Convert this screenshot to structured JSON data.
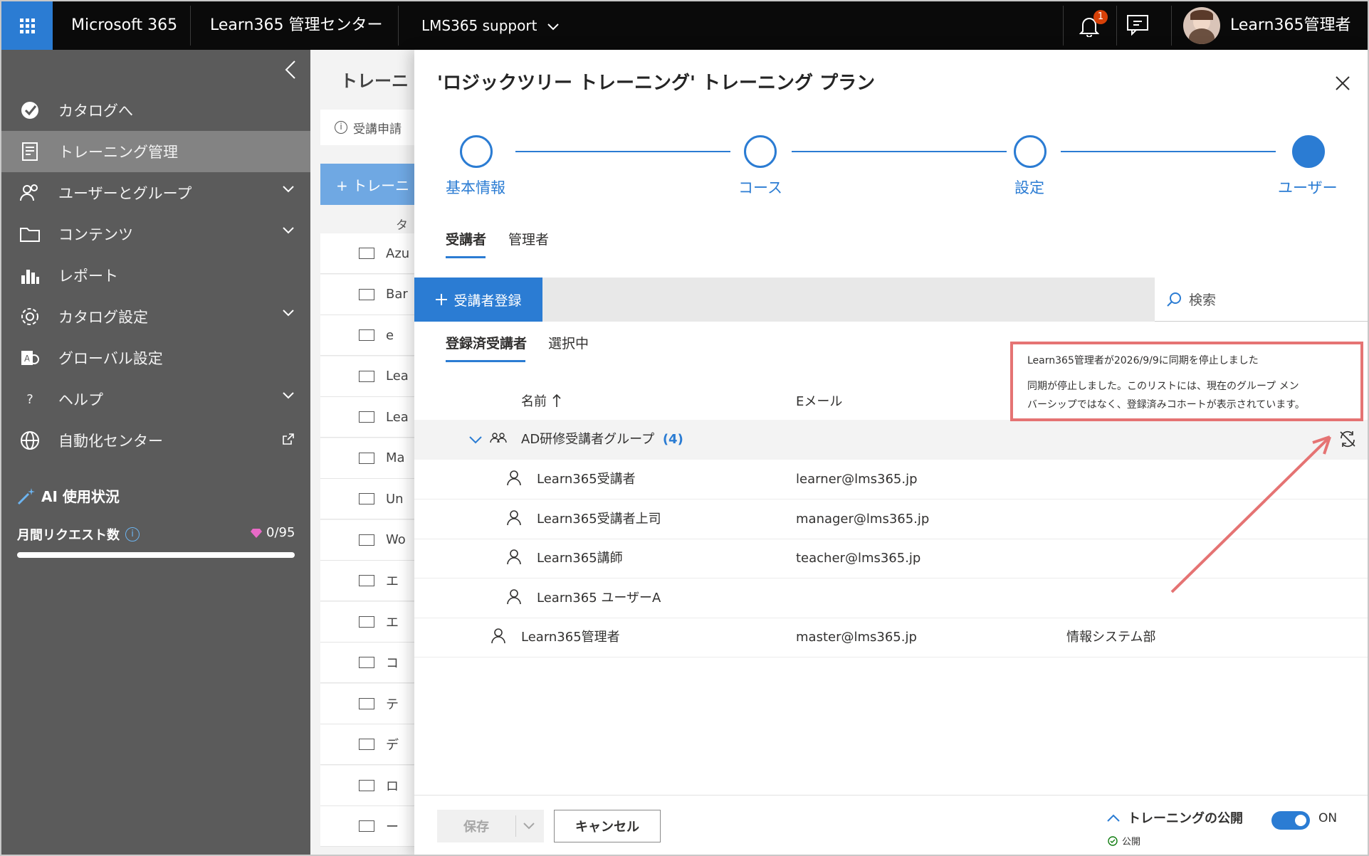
{
  "topbar": {
    "brand": "Microsoft 365",
    "app_title": "Learn365 管理センター",
    "tenant": "LMS365 support",
    "notification_count": "1",
    "user_name": "Learn365管理者"
  },
  "sidebar": {
    "items": [
      {
        "label": "カタログへ",
        "icon": "catalog-check-icon"
      },
      {
        "label": "トレーニング管理",
        "icon": "training-document-icon"
      },
      {
        "label": "ユーザーとグループ",
        "icon": "users-icon"
      },
      {
        "label": "コンテンツ",
        "icon": "folder-icon"
      },
      {
        "label": "レポート",
        "icon": "chart-icon"
      },
      {
        "label": "カタログ設定",
        "icon": "gear-icon"
      },
      {
        "label": "グローバル設定",
        "icon": "global-settings-icon"
      },
      {
        "label": "ヘルプ",
        "icon": "help-icon"
      },
      {
        "label": "自動化センター",
        "icon": "globe-icon"
      }
    ],
    "ai_title": "AI 使用状況",
    "monthly_requests_label": "月間リクエスト数",
    "monthly_requests_value": "0/95"
  },
  "background": {
    "page_title": "トレーニ",
    "info_text": "受講申請",
    "add_button": "+ トレーニ",
    "column_header": "タ",
    "rows": [
      "Azu",
      "Bar",
      "e",
      "Lea",
      "Lea",
      "Ma",
      "Un",
      "Wo",
      "エ",
      "エ",
      "コ",
      "テ",
      "デ",
      "ロ",
      "ー"
    ]
  },
  "panel": {
    "title": "'ロジックツリー トレーニング' トレーニング プラン",
    "steps": [
      "基本情報",
      "コース",
      "設定",
      "ユーザー"
    ],
    "tabs": [
      "受講者",
      "管理者"
    ],
    "add_learner_button": "受講者登録",
    "search_placeholder": "検索",
    "subtabs": [
      "登録済受講者",
      "選択中"
    ],
    "columns": {
      "name": "名前",
      "email": "Eメール"
    },
    "group": {
      "name": "AD研修受講者グループ",
      "count": "(4)"
    },
    "members": [
      {
        "name": "Learn365受講者",
        "email": "learner@lms365.jp"
      },
      {
        "name": "Learn365受講者上司",
        "email": "manager@lms365.jp"
      },
      {
        "name": "Learn365講師",
        "email": "teacher@lms365.jp"
      },
      {
        "name": "Learn365 ユーザーA",
        "email": ""
      }
    ],
    "admin_user": {
      "name": "Learn365管理者",
      "email": "master@lms365.jp",
      "department": "情報システム部"
    },
    "callout": {
      "line1": "Learn365管理者が2026/9/9に同期を停止しました",
      "line2": "同期が停止しました。このリストには、現在のグループ メン",
      "line3": "バーシップではなく、登録済みコホートが表示されています。"
    },
    "footer": {
      "save": "保存",
      "cancel": "キャンセル",
      "publish_label": "トレーニングの公開",
      "publish_status": "公開",
      "toggle_state": "ON"
    }
  },
  "colors": {
    "accent": "#2b7cd3",
    "sidebar": "#5b5b5b",
    "callout_border": "#e57373"
  }
}
